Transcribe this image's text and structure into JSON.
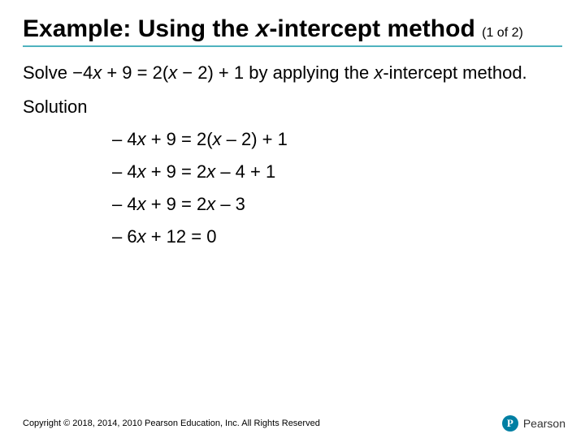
{
  "title": {
    "prefix": "Example: Using the ",
    "var": "x",
    "suffix": "-intercept method",
    "page": "(1 of 2)"
  },
  "problem": {
    "prefix": "Solve −4",
    "v1": "x",
    "mid1": " + 9 = 2(",
    "v2": "x",
    "mid2": " − 2) + 1 by applying the ",
    "v3": "x",
    "suffix": "-intercept method."
  },
  "solution_label": "Solution",
  "equations": [
    {
      "pre": "– 4",
      "v": "x",
      "mid": " + 9 = 2(",
      "v2": "x",
      "post": " – 2) + 1"
    },
    {
      "pre": "– 4",
      "v": "x",
      "mid": " + 9 = 2",
      "v2": "x",
      "post": " – 4 + 1"
    },
    {
      "pre": "– 4",
      "v": "x",
      "mid": " + 9 = 2",
      "v2": "x",
      "post": " – 3"
    },
    {
      "pre": "– 6",
      "v": "x",
      "mid": " + 12 = 0",
      "v2": "",
      "post": ""
    }
  ],
  "copyright": "Copyright © 2018, 2014, 2010 Pearson Education, Inc. All Rights Reserved",
  "logo": {
    "letter": "P",
    "brand": "Pearson"
  }
}
